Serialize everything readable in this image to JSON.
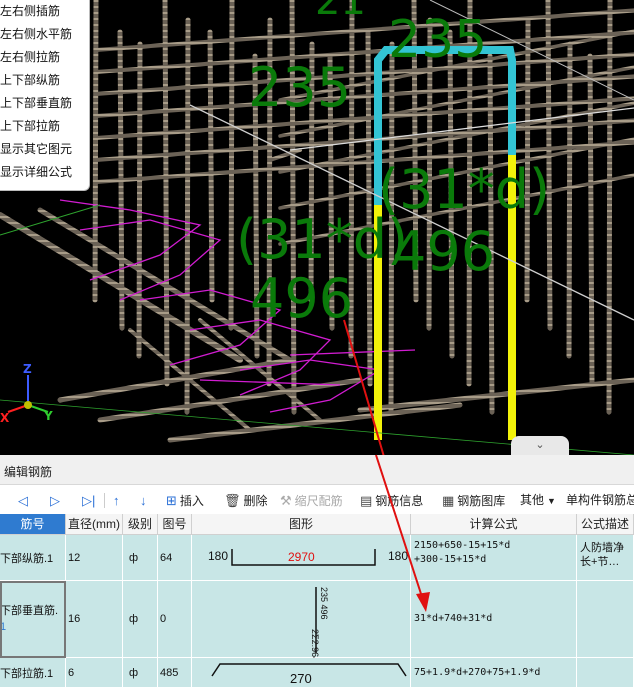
{
  "viewport": {
    "labels": {
      "top_partial": "21",
      "top_235": "235",
      "left_235": "235",
      "right_formula": "(31*d)",
      "right_496": "496",
      "left_formula": "(31*d)",
      "left_496": "496"
    },
    "axis": {
      "z": "Z",
      "y": "Y",
      "x": "X"
    },
    "menu": [
      "左右侧插筋",
      "左右侧水平筋",
      "左右侧拉筋",
      "上下部纵筋",
      "上下部垂直筋",
      "上下部拉筋",
      "显示其它图元",
      "显示详细公式"
    ],
    "collapse_glyph": "⌄"
  },
  "panel": {
    "title": "编辑钢筋",
    "toolbar": {
      "first": "◁",
      "prev": "▷",
      "last": "▷|",
      "up": "↑",
      "down": "↓",
      "insert": "插入",
      "delete": "删除",
      "scale": "缩尺配筋",
      "info": "钢筋信息",
      "library": "钢筋图库",
      "other": "其他",
      "summary": "单构件钢筋总"
    },
    "columns": [
      "筋号",
      "直径(mm)",
      "级别",
      "图号",
      "图形",
      "计算公式",
      "公式描述"
    ],
    "rows": [
      {
        "name": "下部纵筋.1",
        "dia": "12",
        "grade": "ф",
        "fig": "64",
        "shape_left": "180",
        "shape_mid": "2970",
        "shape_right": "180",
        "formula1": "2150+650-15+15*d",
        "formula2": "+300-15+15*d",
        "desc1": "人防墙净",
        "desc2": "长+节…"
      },
      {
        "name": "下部垂直筋.",
        "name2": "1",
        "dia": "16",
        "grade": "ф",
        "fig": "0",
        "shape_text": "2Σ2.964",
        "shape_text2": "235 496",
        "formula1": "31*d+740+31*d",
        "desc1": ""
      },
      {
        "name": "下部拉筋.1",
        "dia": "6",
        "grade": "ф",
        "fig": "485",
        "shape_mid": "270",
        "formula1": "75+1.9*d+270+75+1.9*d",
        "desc1": ""
      }
    ]
  },
  "colors": {
    "accent": "#2f7bd0",
    "row_bg": "#c8e6e6",
    "arrow": "#e01010",
    "dim_text": "#0a7a0a"
  }
}
